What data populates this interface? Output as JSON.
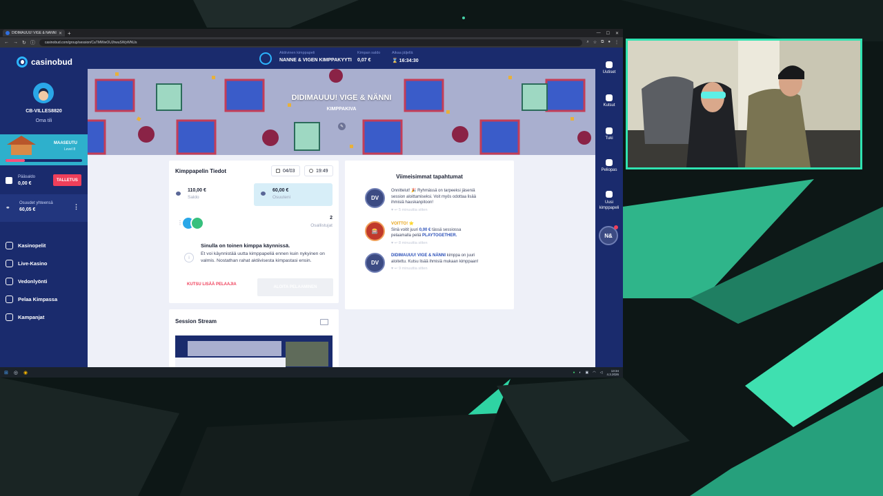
{
  "browser": {
    "tab_title": "DIDIMAUUU! VIGE & NÄNNI",
    "url": "casinobud.com/group/session/CaTMWwOUJhwuSWyWNUs"
  },
  "sidebar": {
    "logo": "casinobud",
    "username": "CB-VILLES8820",
    "my_account": "Oma tili",
    "level_name": "MAASEUTU",
    "level": "Level 8",
    "level_progress": 0.25,
    "balance_label": "Pääsaldo",
    "balance_value": "0,00 €",
    "deposit_button": "TALLETUS",
    "shares_label": "Osuudet yhteensä",
    "shares_value": "60,05 €",
    "nav": [
      {
        "label": "Kasinopelit",
        "icon": "casino-icon"
      },
      {
        "label": "Live-Kasino",
        "icon": "live-icon"
      },
      {
        "label": "Vedonlyönti",
        "icon": "sports-icon"
      },
      {
        "label": "Pelaa Kimpassa",
        "icon": "group-icon"
      },
      {
        "label": "Kampanjat",
        "icon": "gift-icon"
      }
    ]
  },
  "topbar": {
    "active_label": "Aktiivinen kimppapeli",
    "active_value": "NANNE & VIGEN KIMPPAKYYTI",
    "balance_label": "Kimpan saldo",
    "balance_value": "0,07 €",
    "time_label": "Aikaa jäljellä",
    "time_value": "16:34:30"
  },
  "banner": {
    "title": "DIDIMAUUU! VIGE & NÄNNI",
    "subtitle": "KIMPPAKIVA"
  },
  "right_sidebar": [
    {
      "label": "Uutiset",
      "icon": "bell-icon"
    },
    {
      "label": "Kutsut",
      "icon": "invite-icon"
    },
    {
      "label": "Tuki",
      "icon": "chat-icon"
    },
    {
      "label": "Peliopas",
      "icon": "guide-icon"
    },
    {
      "label": "Uusi kimppapeli",
      "icon": "new-group-icon"
    }
  ],
  "right_avatar": "N&",
  "info_card": {
    "title": "Kimppapelin Tiedot",
    "date": "04/03",
    "time": "19:49",
    "saldo_value": "110,00 €",
    "saldo_label": "Saldo",
    "shares_value": "60,00 €",
    "shares_label": "Osuuteni",
    "participant_count": "2",
    "participant_label": "Osallistujat",
    "warning_title": "Sinulla on toinen kimppa käynnissä.",
    "warning_text": "Et voi käynnistää uutta kimppapeliä ennen kuin nykyinen on valmis. Nostathan rahat aktiivisesta kimpastasi ensin.",
    "invite_button": "KUTSU LISÄÄ PELAAJIA",
    "start_button": "ALOITA PELAAMINEN"
  },
  "events": {
    "title": "Viimeisimmat tapahtumat",
    "items": [
      {
        "avatar": "DV",
        "text": "Onnittelut! 🎉 Ryhmässä on tarpeeksi jäseniä session aloittamiseksi. Voit myös odottaa lisää ihmisiä hauskanpitoon!",
        "time": "5 minuuttia sitten"
      },
      {
        "avatar": "",
        "title": "VOITTO! ⭐",
        "text_pre": "Sinä voitit juuri ",
        "amount": "0,00 €",
        "text_mid": " tässä sessiossa pelaamalla peliä ",
        "game": "PLAYTOGETHER.",
        "time": "8 minuuttia sitten"
      },
      {
        "avatar": "DV",
        "name": "DIDIMAUUU! VIGE & NÄNNI",
        "text": " kimppa on juuri aloitettu. Kutsu lisää ihmisiä mukaan kimppaan!",
        "time": "9 minuuttia sitten"
      }
    ]
  },
  "stream": {
    "title": "Session Stream"
  },
  "taskbar": {
    "time": "13:34",
    "date": "4.3.2026"
  },
  "colors": {
    "brand_navy": "#1a2b6d",
    "accent_red": "#ef3f5a",
    "accent_teal": "#2fe3b1"
  }
}
